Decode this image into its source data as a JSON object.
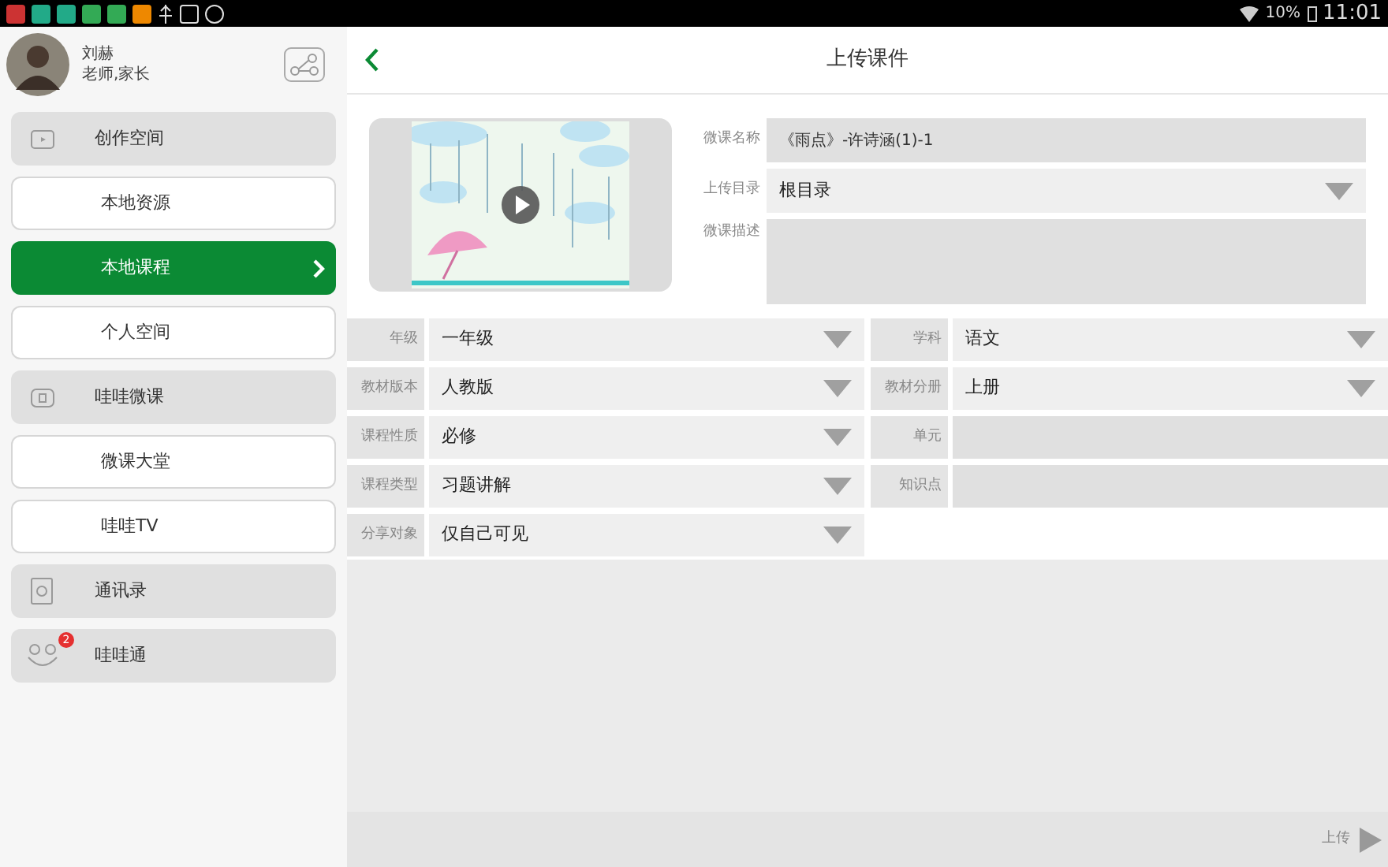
{
  "status_bar": {
    "battery": "10%",
    "time": "11:01"
  },
  "profile": {
    "name": "刘赫",
    "roles": "老师,家长"
  },
  "sidebar": {
    "items": [
      {
        "label": "创作空间",
        "kind": "section",
        "selected": false
      },
      {
        "label": "本地资源",
        "kind": "link",
        "selected": false
      },
      {
        "label": "本地课程",
        "kind": "link",
        "selected": true
      },
      {
        "label": "个人空间",
        "kind": "link",
        "selected": false
      },
      {
        "label": "哇哇微课",
        "kind": "section",
        "selected": false
      },
      {
        "label": "微课大堂",
        "kind": "link",
        "selected": false
      },
      {
        "label": "哇哇TV",
        "kind": "link",
        "selected": false
      },
      {
        "label": "通讯录",
        "kind": "section",
        "selected": false
      },
      {
        "label": "哇哇通",
        "kind": "section",
        "selected": false,
        "badge": "2"
      }
    ]
  },
  "header": {
    "title": "上传课件"
  },
  "course": {
    "name_label": "微课名称",
    "name_value": "《雨点》-许诗涵(1)-1",
    "dir_label": "上传目录",
    "dir_value": "根目录",
    "desc_label": "微课描述"
  },
  "form": [
    {
      "label": "年级",
      "value": "一年级",
      "kind": "select"
    },
    {
      "label": "学科",
      "value": "语文",
      "kind": "select"
    },
    {
      "label": "教材版本",
      "value": "人教版",
      "kind": "select"
    },
    {
      "label": "教材分册",
      "value": "上册",
      "kind": "select"
    },
    {
      "label": "课程性质",
      "value": "必修",
      "kind": "select"
    },
    {
      "label": "单元",
      "kind": "text"
    },
    {
      "label": "课程类型",
      "value": "习题讲解",
      "kind": "select"
    },
    {
      "label": "知识点",
      "kind": "text"
    },
    {
      "label": "分享对象",
      "value": "仅自己可见",
      "kind": "select"
    }
  ],
  "footer": {
    "upload_label": "上传"
  }
}
